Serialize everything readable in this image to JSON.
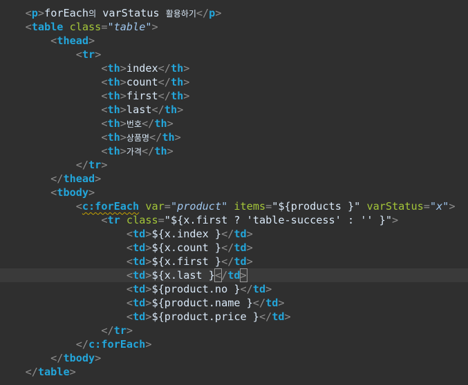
{
  "editor": {
    "lines": [
      {
        "indent": 4,
        "tokens": [
          [
            "br",
            "<"
          ],
          [
            "tag",
            "p"
          ],
          [
            "br",
            ">"
          ],
          [
            "txt",
            "forEach"
          ],
          [
            "ko",
            "의"
          ],
          [
            "txt",
            " varStatus "
          ],
          [
            "ko",
            "활용하기"
          ],
          [
            "br",
            "</"
          ],
          [
            "tag",
            "p"
          ],
          [
            "br",
            ">"
          ]
        ]
      },
      {
        "indent": 4,
        "tokens": [
          [
            "br",
            "<"
          ],
          [
            "tag",
            "table"
          ],
          [
            "txt",
            " "
          ],
          [
            "attr",
            "class"
          ],
          [
            "br",
            "="
          ],
          [
            "val",
            "\"table\""
          ],
          [
            "br",
            ">"
          ]
        ]
      },
      {
        "indent": 8,
        "tokens": [
          [
            "br",
            "<"
          ],
          [
            "tag",
            "thead"
          ],
          [
            "br",
            ">"
          ]
        ]
      },
      {
        "indent": 12,
        "tokens": [
          [
            "br",
            "<"
          ],
          [
            "tag",
            "tr"
          ],
          [
            "br",
            ">"
          ]
        ]
      },
      {
        "indent": 16,
        "tokens": [
          [
            "br",
            "<"
          ],
          [
            "tag",
            "th"
          ],
          [
            "br",
            ">"
          ],
          [
            "txt",
            "index"
          ],
          [
            "br",
            "</"
          ],
          [
            "tag",
            "th"
          ],
          [
            "br",
            ">"
          ]
        ]
      },
      {
        "indent": 16,
        "tokens": [
          [
            "br",
            "<"
          ],
          [
            "tag",
            "th"
          ],
          [
            "br",
            ">"
          ],
          [
            "txt",
            "count"
          ],
          [
            "br",
            "</"
          ],
          [
            "tag",
            "th"
          ],
          [
            "br",
            ">"
          ]
        ]
      },
      {
        "indent": 16,
        "tokens": [
          [
            "br",
            "<"
          ],
          [
            "tag",
            "th"
          ],
          [
            "br",
            ">"
          ],
          [
            "txt",
            "first"
          ],
          [
            "br",
            "</"
          ],
          [
            "tag",
            "th"
          ],
          [
            "br",
            ">"
          ]
        ]
      },
      {
        "indent": 16,
        "tokens": [
          [
            "br",
            "<"
          ],
          [
            "tag",
            "th"
          ],
          [
            "br",
            ">"
          ],
          [
            "txt",
            "last"
          ],
          [
            "br",
            "</"
          ],
          [
            "tag",
            "th"
          ],
          [
            "br",
            ">"
          ]
        ]
      },
      {
        "indent": 16,
        "tokens": [
          [
            "br",
            "<"
          ],
          [
            "tag",
            "th"
          ],
          [
            "br",
            ">"
          ],
          [
            "ko",
            "번호"
          ],
          [
            "br",
            "</"
          ],
          [
            "tag",
            "th"
          ],
          [
            "br",
            ">"
          ]
        ]
      },
      {
        "indent": 16,
        "tokens": [
          [
            "br",
            "<"
          ],
          [
            "tag",
            "th"
          ],
          [
            "br",
            ">"
          ],
          [
            "ko",
            "상품명"
          ],
          [
            "br",
            "</"
          ],
          [
            "tag",
            "th"
          ],
          [
            "br",
            ">"
          ]
        ]
      },
      {
        "indent": 16,
        "tokens": [
          [
            "br",
            "<"
          ],
          [
            "tag",
            "th"
          ],
          [
            "br",
            ">"
          ],
          [
            "ko",
            "가격"
          ],
          [
            "br",
            "</"
          ],
          [
            "tag",
            "th"
          ],
          [
            "br",
            ">"
          ]
        ]
      },
      {
        "indent": 12,
        "tokens": [
          [
            "br",
            "</"
          ],
          [
            "tag",
            "tr"
          ],
          [
            "br",
            ">"
          ]
        ]
      },
      {
        "indent": 8,
        "tokens": [
          [
            "br",
            "</"
          ],
          [
            "tag",
            "thead"
          ],
          [
            "br",
            ">"
          ]
        ]
      },
      {
        "indent": 8,
        "tokens": [
          [
            "br",
            "<"
          ],
          [
            "tag",
            "tbody"
          ],
          [
            "br",
            ">"
          ]
        ]
      },
      {
        "indent": 12,
        "tokens": [
          [
            "br",
            "<"
          ],
          [
            "tagsq",
            "c:forEach"
          ],
          [
            "txt",
            " "
          ],
          [
            "attr",
            "var"
          ],
          [
            "br",
            "="
          ],
          [
            "val",
            "\"product\""
          ],
          [
            "txt",
            " "
          ],
          [
            "attr",
            "items"
          ],
          [
            "br",
            "="
          ],
          [
            "str",
            "\"${products }\""
          ],
          [
            "txt",
            " "
          ],
          [
            "attr",
            "varStatus"
          ],
          [
            "br",
            "="
          ],
          [
            "val",
            "\"x\""
          ],
          [
            "br",
            ">"
          ]
        ]
      },
      {
        "indent": 16,
        "tokens": [
          [
            "br",
            "<"
          ],
          [
            "tag",
            "tr"
          ],
          [
            "txt",
            " "
          ],
          [
            "attr",
            "class"
          ],
          [
            "br",
            "="
          ],
          [
            "str",
            "\"${x.first ? 'table-success' : '' }\""
          ],
          [
            "br",
            ">"
          ]
        ]
      },
      {
        "indent": 20,
        "tokens": [
          [
            "br",
            "<"
          ],
          [
            "tag",
            "td"
          ],
          [
            "br",
            ">"
          ],
          [
            "txt",
            "${x.index }"
          ],
          [
            "br",
            "</"
          ],
          [
            "tag",
            "td"
          ],
          [
            "br",
            ">"
          ]
        ]
      },
      {
        "indent": 20,
        "tokens": [
          [
            "br",
            "<"
          ],
          [
            "tag",
            "td"
          ],
          [
            "br",
            ">"
          ],
          [
            "txt",
            "${x.count }"
          ],
          [
            "br",
            "</"
          ],
          [
            "tag",
            "td"
          ],
          [
            "br",
            ">"
          ]
        ]
      },
      {
        "indent": 20,
        "tokens": [
          [
            "br",
            "<"
          ],
          [
            "tag",
            "td"
          ],
          [
            "br",
            ">"
          ],
          [
            "txt",
            "${x.first }"
          ],
          [
            "br",
            "</"
          ],
          [
            "tag",
            "td"
          ],
          [
            "br",
            ">"
          ]
        ]
      },
      {
        "indent": 20,
        "active": true,
        "tokens": [
          [
            "br",
            "<"
          ],
          [
            "tag",
            "td"
          ],
          [
            "br",
            ">"
          ],
          [
            "txt",
            "${x.last }"
          ],
          [
            "brhl",
            "<"
          ],
          [
            "br",
            "/"
          ],
          [
            "tag",
            "td"
          ],
          [
            "brhl",
            ">"
          ],
          [
            "caret",
            ""
          ]
        ]
      },
      {
        "indent": 20,
        "tokens": [
          [
            "br",
            "<"
          ],
          [
            "tag",
            "td"
          ],
          [
            "br",
            ">"
          ],
          [
            "txt",
            "${product.no }"
          ],
          [
            "br",
            "</"
          ],
          [
            "tag",
            "td"
          ],
          [
            "br",
            ">"
          ]
        ]
      },
      {
        "indent": 20,
        "tokens": [
          [
            "br",
            "<"
          ],
          [
            "tag",
            "td"
          ],
          [
            "br",
            ">"
          ],
          [
            "txt",
            "${product.name }"
          ],
          [
            "br",
            "</"
          ],
          [
            "tag",
            "td"
          ],
          [
            "br",
            ">"
          ]
        ]
      },
      {
        "indent": 20,
        "tokens": [
          [
            "br",
            "<"
          ],
          [
            "tag",
            "td"
          ],
          [
            "br",
            ">"
          ],
          [
            "txt",
            "${product.price }"
          ],
          [
            "br",
            "</"
          ],
          [
            "tag",
            "td"
          ],
          [
            "br",
            ">"
          ]
        ]
      },
      {
        "indent": 16,
        "tokens": [
          [
            "br",
            "</"
          ],
          [
            "tag",
            "tr"
          ],
          [
            "br",
            ">"
          ]
        ]
      },
      {
        "indent": 12,
        "tokens": [
          [
            "br",
            "</"
          ],
          [
            "tag",
            "c:forEach"
          ],
          [
            "br",
            ">"
          ]
        ]
      },
      {
        "indent": 8,
        "tokens": [
          [
            "br",
            "</"
          ],
          [
            "tag",
            "tbody"
          ],
          [
            "br",
            ">"
          ]
        ]
      },
      {
        "indent": 4,
        "tokens": [
          [
            "br",
            "</"
          ],
          [
            "tag",
            "table"
          ],
          [
            "br",
            ">"
          ]
        ]
      }
    ]
  }
}
